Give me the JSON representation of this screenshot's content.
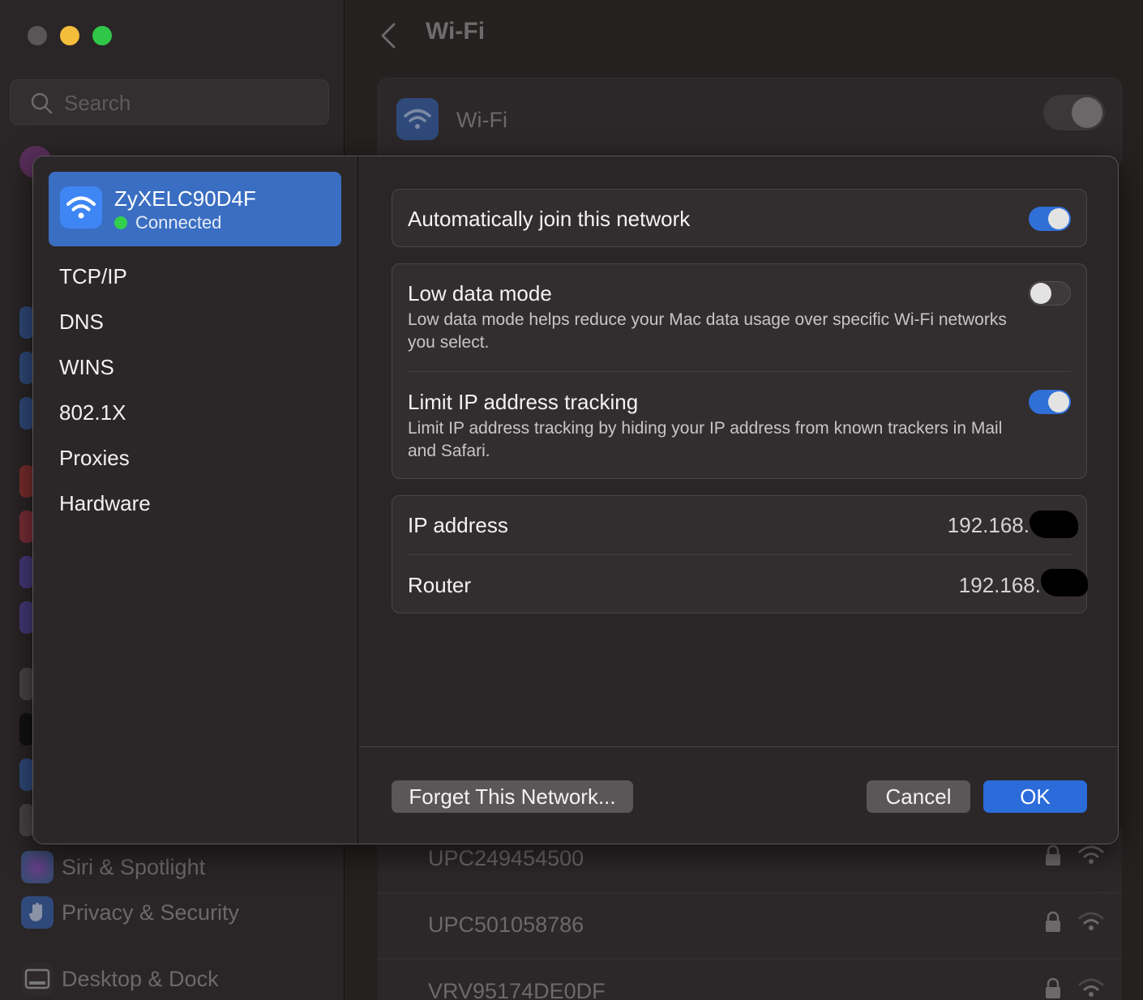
{
  "background": {
    "search_placeholder": "Search",
    "title": "Wi-Fi",
    "wifi_label": "Wi-Fi",
    "sidebar_items": [
      {
        "label": "Siri & Spotlight",
        "icon": "siri-icon"
      },
      {
        "label": "Privacy & Security",
        "icon": "hand-icon"
      },
      {
        "label": "Desktop & Dock",
        "icon": "dock-icon"
      }
    ],
    "networks": [
      {
        "name": "UPC249454500"
      },
      {
        "name": "UPC501058786"
      },
      {
        "name": "VRV95174DE0DF"
      }
    ]
  },
  "sheet": {
    "network": {
      "name": "ZyXELC90D4F",
      "status": "Connected",
      "status_color": "#33d04e",
      "icon": "wifi-icon"
    },
    "nav": [
      "TCP/IP",
      "DNS",
      "WINS",
      "802.1X",
      "Proxies",
      "Hardware"
    ],
    "auto_join": {
      "label": "Automatically join this network",
      "enabled": true
    },
    "low_data": {
      "label": "Low data mode",
      "description": "Low data mode helps reduce your Mac data usage over specific Wi-Fi networks you select.",
      "enabled": false
    },
    "limit_ip": {
      "label": "Limit IP address tracking",
      "description": "Limit IP address tracking by hiding your IP address from known trackers in Mail and Safari.",
      "enabled": true
    },
    "ip_address": {
      "label": "IP address",
      "value": "192.168."
    },
    "router": {
      "label": "Router",
      "value": "192.168."
    },
    "buttons": {
      "forget": "Forget This Network...",
      "cancel": "Cancel",
      "ok": "OK"
    }
  },
  "colors": {
    "accent": "#2b6bda",
    "selected_row": "#3a6ec2"
  }
}
